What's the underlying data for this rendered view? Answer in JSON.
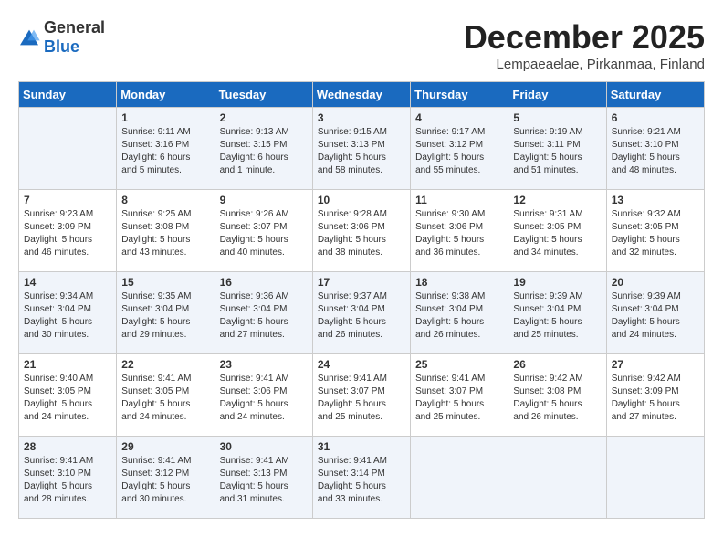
{
  "logo": {
    "general": "General",
    "blue": "Blue"
  },
  "title": "December 2025",
  "subtitle": "Lempaeaelae, Pirkanmaa, Finland",
  "days_of_week": [
    "Sunday",
    "Monday",
    "Tuesday",
    "Wednesday",
    "Thursday",
    "Friday",
    "Saturday"
  ],
  "weeks": [
    [
      {
        "day": "",
        "info": ""
      },
      {
        "day": "1",
        "info": "Sunrise: 9:11 AM\nSunset: 3:16 PM\nDaylight: 6 hours\nand 5 minutes."
      },
      {
        "day": "2",
        "info": "Sunrise: 9:13 AM\nSunset: 3:15 PM\nDaylight: 6 hours\nand 1 minute."
      },
      {
        "day": "3",
        "info": "Sunrise: 9:15 AM\nSunset: 3:13 PM\nDaylight: 5 hours\nand 58 minutes."
      },
      {
        "day": "4",
        "info": "Sunrise: 9:17 AM\nSunset: 3:12 PM\nDaylight: 5 hours\nand 55 minutes."
      },
      {
        "day": "5",
        "info": "Sunrise: 9:19 AM\nSunset: 3:11 PM\nDaylight: 5 hours\nand 51 minutes."
      },
      {
        "day": "6",
        "info": "Sunrise: 9:21 AM\nSunset: 3:10 PM\nDaylight: 5 hours\nand 48 minutes."
      }
    ],
    [
      {
        "day": "7",
        "info": "Sunrise: 9:23 AM\nSunset: 3:09 PM\nDaylight: 5 hours\nand 46 minutes."
      },
      {
        "day": "8",
        "info": "Sunrise: 9:25 AM\nSunset: 3:08 PM\nDaylight: 5 hours\nand 43 minutes."
      },
      {
        "day": "9",
        "info": "Sunrise: 9:26 AM\nSunset: 3:07 PM\nDaylight: 5 hours\nand 40 minutes."
      },
      {
        "day": "10",
        "info": "Sunrise: 9:28 AM\nSunset: 3:06 PM\nDaylight: 5 hours\nand 38 minutes."
      },
      {
        "day": "11",
        "info": "Sunrise: 9:30 AM\nSunset: 3:06 PM\nDaylight: 5 hours\nand 36 minutes."
      },
      {
        "day": "12",
        "info": "Sunrise: 9:31 AM\nSunset: 3:05 PM\nDaylight: 5 hours\nand 34 minutes."
      },
      {
        "day": "13",
        "info": "Sunrise: 9:32 AM\nSunset: 3:05 PM\nDaylight: 5 hours\nand 32 minutes."
      }
    ],
    [
      {
        "day": "14",
        "info": "Sunrise: 9:34 AM\nSunset: 3:04 PM\nDaylight: 5 hours\nand 30 minutes."
      },
      {
        "day": "15",
        "info": "Sunrise: 9:35 AM\nSunset: 3:04 PM\nDaylight: 5 hours\nand 29 minutes."
      },
      {
        "day": "16",
        "info": "Sunrise: 9:36 AM\nSunset: 3:04 PM\nDaylight: 5 hours\nand 27 minutes."
      },
      {
        "day": "17",
        "info": "Sunrise: 9:37 AM\nSunset: 3:04 PM\nDaylight: 5 hours\nand 26 minutes."
      },
      {
        "day": "18",
        "info": "Sunrise: 9:38 AM\nSunset: 3:04 PM\nDaylight: 5 hours\nand 26 minutes."
      },
      {
        "day": "19",
        "info": "Sunrise: 9:39 AM\nSunset: 3:04 PM\nDaylight: 5 hours\nand 25 minutes."
      },
      {
        "day": "20",
        "info": "Sunrise: 9:39 AM\nSunset: 3:04 PM\nDaylight: 5 hours\nand 24 minutes."
      }
    ],
    [
      {
        "day": "21",
        "info": "Sunrise: 9:40 AM\nSunset: 3:05 PM\nDaylight: 5 hours\nand 24 minutes."
      },
      {
        "day": "22",
        "info": "Sunrise: 9:41 AM\nSunset: 3:05 PM\nDaylight: 5 hours\nand 24 minutes."
      },
      {
        "day": "23",
        "info": "Sunrise: 9:41 AM\nSunset: 3:06 PM\nDaylight: 5 hours\nand 24 minutes."
      },
      {
        "day": "24",
        "info": "Sunrise: 9:41 AM\nSunset: 3:07 PM\nDaylight: 5 hours\nand 25 minutes."
      },
      {
        "day": "25",
        "info": "Sunrise: 9:41 AM\nSunset: 3:07 PM\nDaylight: 5 hours\nand 25 minutes."
      },
      {
        "day": "26",
        "info": "Sunrise: 9:42 AM\nSunset: 3:08 PM\nDaylight: 5 hours\nand 26 minutes."
      },
      {
        "day": "27",
        "info": "Sunrise: 9:42 AM\nSunset: 3:09 PM\nDaylight: 5 hours\nand 27 minutes."
      }
    ],
    [
      {
        "day": "28",
        "info": "Sunrise: 9:41 AM\nSunset: 3:10 PM\nDaylight: 5 hours\nand 28 minutes."
      },
      {
        "day": "29",
        "info": "Sunrise: 9:41 AM\nSunset: 3:12 PM\nDaylight: 5 hours\nand 30 minutes."
      },
      {
        "day": "30",
        "info": "Sunrise: 9:41 AM\nSunset: 3:13 PM\nDaylight: 5 hours\nand 31 minutes."
      },
      {
        "day": "31",
        "info": "Sunrise: 9:41 AM\nSunset: 3:14 PM\nDaylight: 5 hours\nand 33 minutes."
      },
      {
        "day": "",
        "info": ""
      },
      {
        "day": "",
        "info": ""
      },
      {
        "day": "",
        "info": ""
      }
    ]
  ]
}
